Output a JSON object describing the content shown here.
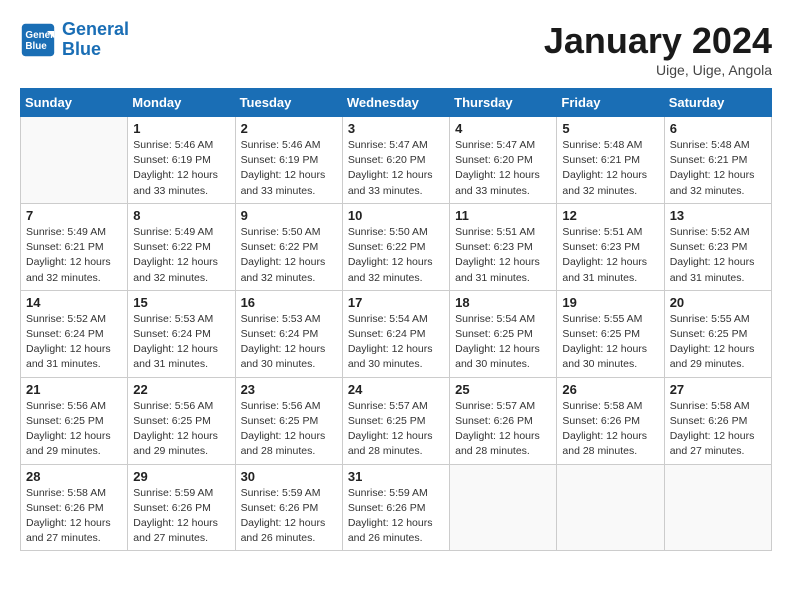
{
  "header": {
    "logo_line1": "General",
    "logo_line2": "Blue",
    "month": "January 2024",
    "location": "Uige, Uige, Angola"
  },
  "days_of_week": [
    "Sunday",
    "Monday",
    "Tuesday",
    "Wednesday",
    "Thursday",
    "Friday",
    "Saturday"
  ],
  "weeks": [
    [
      {
        "num": "",
        "info": ""
      },
      {
        "num": "1",
        "info": "Sunrise: 5:46 AM\nSunset: 6:19 PM\nDaylight: 12 hours\nand 33 minutes."
      },
      {
        "num": "2",
        "info": "Sunrise: 5:46 AM\nSunset: 6:19 PM\nDaylight: 12 hours\nand 33 minutes."
      },
      {
        "num": "3",
        "info": "Sunrise: 5:47 AM\nSunset: 6:20 PM\nDaylight: 12 hours\nand 33 minutes."
      },
      {
        "num": "4",
        "info": "Sunrise: 5:47 AM\nSunset: 6:20 PM\nDaylight: 12 hours\nand 33 minutes."
      },
      {
        "num": "5",
        "info": "Sunrise: 5:48 AM\nSunset: 6:21 PM\nDaylight: 12 hours\nand 32 minutes."
      },
      {
        "num": "6",
        "info": "Sunrise: 5:48 AM\nSunset: 6:21 PM\nDaylight: 12 hours\nand 32 minutes."
      }
    ],
    [
      {
        "num": "7",
        "info": "Sunrise: 5:49 AM\nSunset: 6:21 PM\nDaylight: 12 hours\nand 32 minutes."
      },
      {
        "num": "8",
        "info": "Sunrise: 5:49 AM\nSunset: 6:22 PM\nDaylight: 12 hours\nand 32 minutes."
      },
      {
        "num": "9",
        "info": "Sunrise: 5:50 AM\nSunset: 6:22 PM\nDaylight: 12 hours\nand 32 minutes."
      },
      {
        "num": "10",
        "info": "Sunrise: 5:50 AM\nSunset: 6:22 PM\nDaylight: 12 hours\nand 32 minutes."
      },
      {
        "num": "11",
        "info": "Sunrise: 5:51 AM\nSunset: 6:23 PM\nDaylight: 12 hours\nand 31 minutes."
      },
      {
        "num": "12",
        "info": "Sunrise: 5:51 AM\nSunset: 6:23 PM\nDaylight: 12 hours\nand 31 minutes."
      },
      {
        "num": "13",
        "info": "Sunrise: 5:52 AM\nSunset: 6:23 PM\nDaylight: 12 hours\nand 31 minutes."
      }
    ],
    [
      {
        "num": "14",
        "info": "Sunrise: 5:52 AM\nSunset: 6:24 PM\nDaylight: 12 hours\nand 31 minutes."
      },
      {
        "num": "15",
        "info": "Sunrise: 5:53 AM\nSunset: 6:24 PM\nDaylight: 12 hours\nand 31 minutes."
      },
      {
        "num": "16",
        "info": "Sunrise: 5:53 AM\nSunset: 6:24 PM\nDaylight: 12 hours\nand 30 minutes."
      },
      {
        "num": "17",
        "info": "Sunrise: 5:54 AM\nSunset: 6:24 PM\nDaylight: 12 hours\nand 30 minutes."
      },
      {
        "num": "18",
        "info": "Sunrise: 5:54 AM\nSunset: 6:25 PM\nDaylight: 12 hours\nand 30 minutes."
      },
      {
        "num": "19",
        "info": "Sunrise: 5:55 AM\nSunset: 6:25 PM\nDaylight: 12 hours\nand 30 minutes."
      },
      {
        "num": "20",
        "info": "Sunrise: 5:55 AM\nSunset: 6:25 PM\nDaylight: 12 hours\nand 29 minutes."
      }
    ],
    [
      {
        "num": "21",
        "info": "Sunrise: 5:56 AM\nSunset: 6:25 PM\nDaylight: 12 hours\nand 29 minutes."
      },
      {
        "num": "22",
        "info": "Sunrise: 5:56 AM\nSunset: 6:25 PM\nDaylight: 12 hours\nand 29 minutes."
      },
      {
        "num": "23",
        "info": "Sunrise: 5:56 AM\nSunset: 6:25 PM\nDaylight: 12 hours\nand 28 minutes."
      },
      {
        "num": "24",
        "info": "Sunrise: 5:57 AM\nSunset: 6:25 PM\nDaylight: 12 hours\nand 28 minutes."
      },
      {
        "num": "25",
        "info": "Sunrise: 5:57 AM\nSunset: 6:26 PM\nDaylight: 12 hours\nand 28 minutes."
      },
      {
        "num": "26",
        "info": "Sunrise: 5:58 AM\nSunset: 6:26 PM\nDaylight: 12 hours\nand 28 minutes."
      },
      {
        "num": "27",
        "info": "Sunrise: 5:58 AM\nSunset: 6:26 PM\nDaylight: 12 hours\nand 27 minutes."
      }
    ],
    [
      {
        "num": "28",
        "info": "Sunrise: 5:58 AM\nSunset: 6:26 PM\nDaylight: 12 hours\nand 27 minutes."
      },
      {
        "num": "29",
        "info": "Sunrise: 5:59 AM\nSunset: 6:26 PM\nDaylight: 12 hours\nand 27 minutes."
      },
      {
        "num": "30",
        "info": "Sunrise: 5:59 AM\nSunset: 6:26 PM\nDaylight: 12 hours\nand 26 minutes."
      },
      {
        "num": "31",
        "info": "Sunrise: 5:59 AM\nSunset: 6:26 PM\nDaylight: 12 hours\nand 26 minutes."
      },
      {
        "num": "",
        "info": ""
      },
      {
        "num": "",
        "info": ""
      },
      {
        "num": "",
        "info": ""
      }
    ]
  ]
}
